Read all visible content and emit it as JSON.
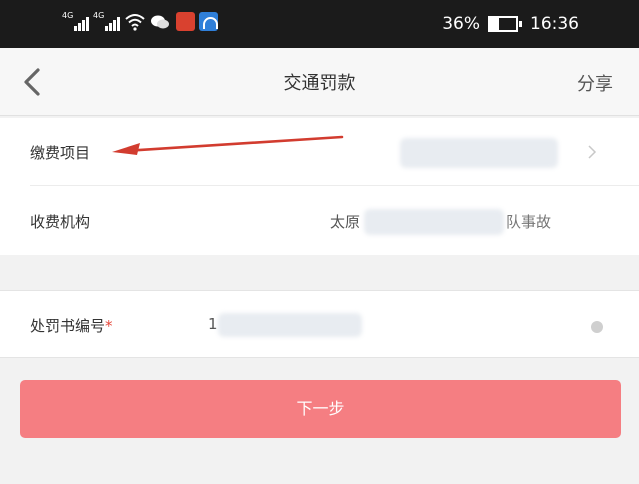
{
  "status_bar": {
    "signal1_tag": "4G",
    "signal2_tag": "4G",
    "battery_level": 0.36,
    "battery_text": "36%",
    "time": "16:36"
  },
  "nav": {
    "title": "交通罚款",
    "share_label": "分享"
  },
  "form": {
    "payment_item_label": "缴费项目",
    "agency_label": "收费机构",
    "agency_value_partial": "太原",
    "agency_value_tail": "队事故",
    "ticket_number_label": "处罚书编号",
    "required_mark": "*",
    "ticket_number_prefix": "1"
  },
  "actions": {
    "next_label": "下一步"
  },
  "colors": {
    "status_bar_bg": "#1b1b1b",
    "primary_button": "#f57e82",
    "annotation_arrow": "#d23c2f",
    "required_mark": "#e5473a"
  }
}
